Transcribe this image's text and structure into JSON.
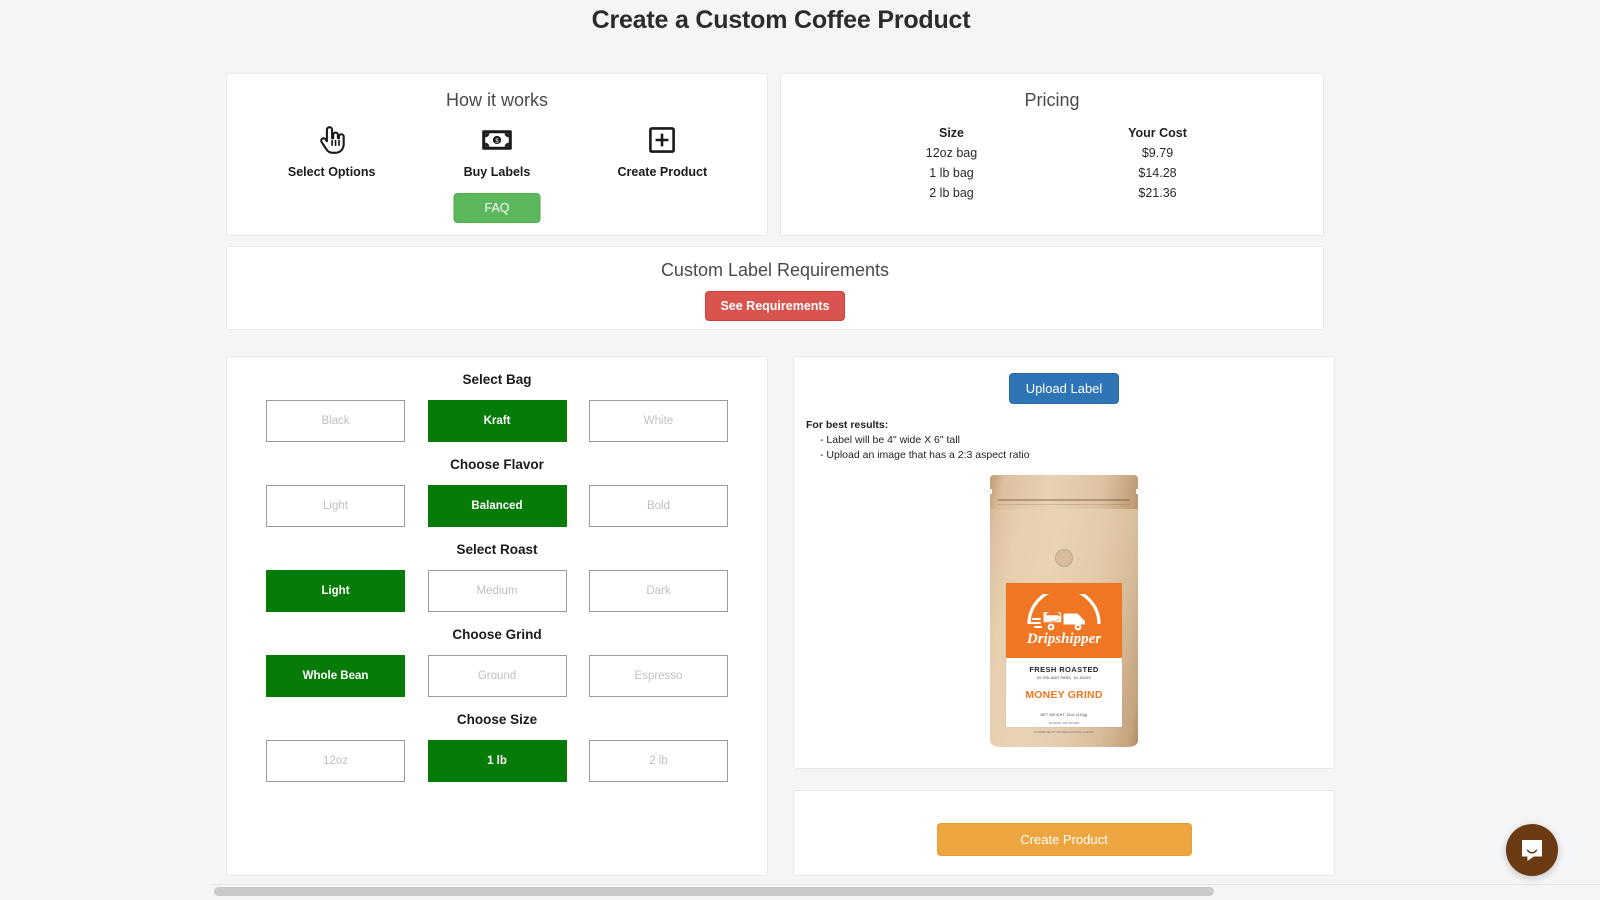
{
  "page": {
    "title": "Create a Custom Coffee Product"
  },
  "how_it_works": {
    "title": "How it works",
    "steps": [
      {
        "label": "Select Options",
        "icon": "pointing-hand-icon"
      },
      {
        "label": "Buy Labels",
        "icon": "money-bill-icon"
      },
      {
        "label": "Create Product",
        "icon": "plus-square-icon"
      }
    ],
    "faq_label": "FAQ"
  },
  "pricing": {
    "title": "Pricing",
    "columns": [
      "Size",
      "Your Cost"
    ],
    "rows": [
      {
        "size": "12oz bag",
        "cost": "$9.79"
      },
      {
        "size": "1 lb bag",
        "cost": "$14.28"
      },
      {
        "size": "2 lb bag",
        "cost": "$21.36"
      }
    ]
  },
  "requirements": {
    "title": "Custom Label Requirements",
    "button_label": "See Requirements"
  },
  "options": {
    "groups": [
      {
        "title": "Select Bag",
        "name": "bag",
        "choices": [
          {
            "label": "Black",
            "selected": false
          },
          {
            "label": "Kraft",
            "selected": true
          },
          {
            "label": "White",
            "selected": false
          }
        ]
      },
      {
        "title": "Choose Flavor",
        "name": "flavor",
        "choices": [
          {
            "label": "Light",
            "selected": false
          },
          {
            "label": "Balanced",
            "selected": true
          },
          {
            "label": "Bold",
            "selected": false
          }
        ]
      },
      {
        "title": "Select Roast",
        "name": "roast",
        "choices": [
          {
            "label": "Light",
            "selected": true
          },
          {
            "label": "Medium",
            "selected": false
          },
          {
            "label": "Dark",
            "selected": false
          }
        ]
      },
      {
        "title": "Choose Grind",
        "name": "grind",
        "choices": [
          {
            "label": "Whole Bean",
            "selected": true
          },
          {
            "label": "Ground",
            "selected": false
          },
          {
            "label": "Espresso",
            "selected": false
          }
        ]
      },
      {
        "title": "Choose Size",
        "name": "size",
        "choices": [
          {
            "label": "12oz",
            "selected": false
          },
          {
            "label": "1 lb",
            "selected": true
          },
          {
            "label": "2 lb",
            "selected": false
          }
        ]
      }
    ]
  },
  "preview": {
    "upload_label": "Upload Label",
    "tips_heading": "For best results:",
    "tips": [
      "- Label will be 4\" wide X 6\" tall",
      "- Upload an image that has a 2:3 aspect ratio"
    ],
    "bag": {
      "brand": "Dripshipper",
      "fresh_roasted": "FRESH ROASTED",
      "roasted_location": "IN ORLAND PARK, ILLINOIS",
      "product_name": "MONEY GRIND",
      "net_weight": "NET WEIGHT  12oz (340g)",
      "fine_print_1": "ROASTED, AND PACKED",
      "fine_print_2": "DISTRIBUTED BY COFFEE ROASTERS, ILLINOIS"
    }
  },
  "create": {
    "button_label": "Create Product"
  },
  "chat": {
    "icon": "chat-bubble-icon"
  },
  "colors": {
    "selected_green": "#067B07",
    "faq_green": "#5CB85C",
    "requirements_red": "#D9534F",
    "upload_blue": "#2E75B6",
    "create_orange": "#EDA63F",
    "label_orange": "#EF7622",
    "chat_brown": "#6B3A12",
    "page_bg": "#F4F5F7"
  }
}
